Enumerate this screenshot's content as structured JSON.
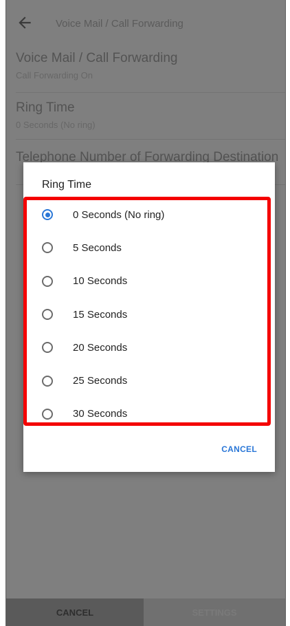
{
  "app_bar": {
    "back_icon": "arrow-left-icon",
    "title": "Voice Mail / Call Forwarding"
  },
  "settings": [
    {
      "title": "Voice Mail / Call Forwarding",
      "subtitle": "Call Forwarding On"
    },
    {
      "title": "Ring Time",
      "subtitle": "0 Seconds (No ring)"
    },
    {
      "title": "Telephone Number of Forwarding Destination",
      "subtitle": ""
    }
  ],
  "bottom_bar": {
    "cancel_label": "CANCEL",
    "settings_label": "SETTINGS"
  },
  "dialog": {
    "title": "Ring Time",
    "options": [
      {
        "label": "0 Seconds (No ring)",
        "checked": true
      },
      {
        "label": "5 Seconds",
        "checked": false
      },
      {
        "label": "10 Seconds",
        "checked": false
      },
      {
        "label": "15 Seconds",
        "checked": false
      },
      {
        "label": "20 Seconds",
        "checked": false
      },
      {
        "label": "25 Seconds",
        "checked": false
      },
      {
        "label": "30 Seconds",
        "checked": false
      }
    ],
    "cancel_label": "CANCEL"
  },
  "colors": {
    "accent": "#2a77d7",
    "highlight": "#f40000",
    "scrim": "#7f7f7f"
  }
}
